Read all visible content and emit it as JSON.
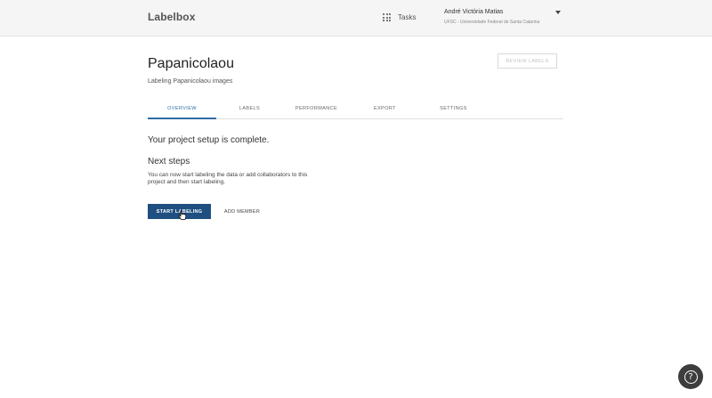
{
  "header": {
    "logo_text": "Labelbox",
    "tasks_label": "Tasks",
    "tasks_icon": "grid-icon",
    "user_name": "André Victória Matias",
    "user_org": "UFSC - Universidade Federal de Santa Catarina"
  },
  "project": {
    "title": "Papanicolaou",
    "description": "Labeling Papanicolaou images",
    "review_label": "REVIEW LABELS"
  },
  "tabs": [
    {
      "label": "OVERVIEW",
      "active": true
    },
    {
      "label": "LABELS",
      "active": false
    },
    {
      "label": "PERFORMANCE",
      "active": false
    },
    {
      "label": "EXPORT",
      "active": false
    },
    {
      "label": "SETTINGS",
      "active": false
    }
  ],
  "overview": {
    "status": "Your project setup is complete.",
    "next_heading": "Next steps",
    "next_text": "You can now start labeling the data or add collaborators to this project and then start labeling.",
    "start_label": "START LABELING",
    "add_label": "ADD MEMBER"
  },
  "help": {
    "glyph": "?"
  },
  "colors": {
    "accent": "#2d6ea3",
    "primary_button": "#1f4f80",
    "topbar": "#f5f5f5"
  }
}
